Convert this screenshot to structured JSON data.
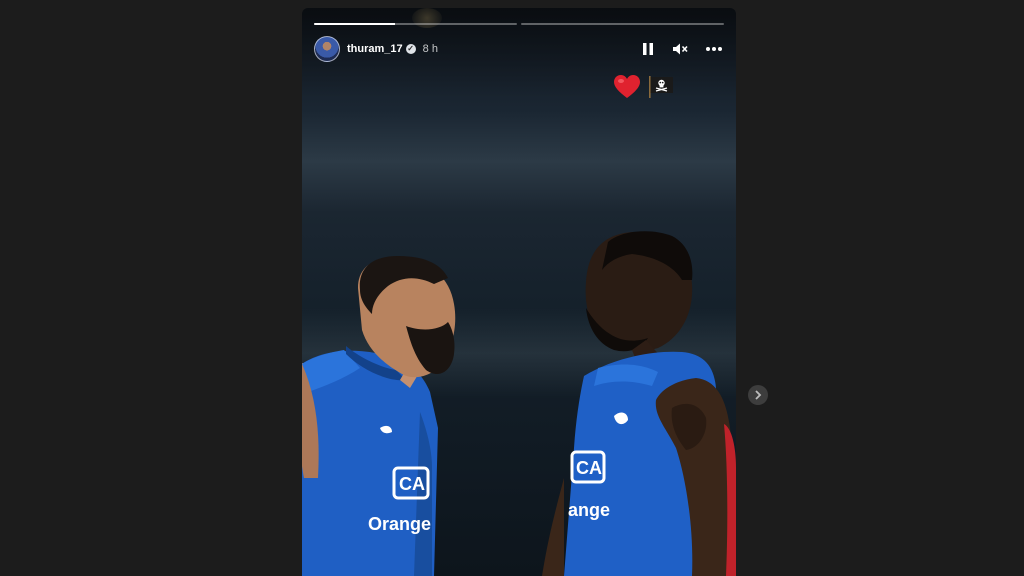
{
  "page": {
    "background_color": "#1c1c1c"
  },
  "story": {
    "progress_segments": [
      {
        "state": "active",
        "progress": 0.4
      },
      {
        "state": "upcoming",
        "progress": 0
      }
    ],
    "username": "thuram_17",
    "verified": true,
    "verified_icon": "checkmark-icon",
    "time_ago": "8 h",
    "controls": [
      "pause-icon",
      "mute-icon",
      "more-icon"
    ],
    "stickers": [
      "heart-emoji",
      "pirate-flag-emoji"
    ],
    "jersey": {
      "sponsor_logo": "CA",
      "sponsor_name": "Orange",
      "sponsor_name_right": "ange"
    }
  },
  "navigation": {
    "next_icon": "chevron-right-icon"
  }
}
